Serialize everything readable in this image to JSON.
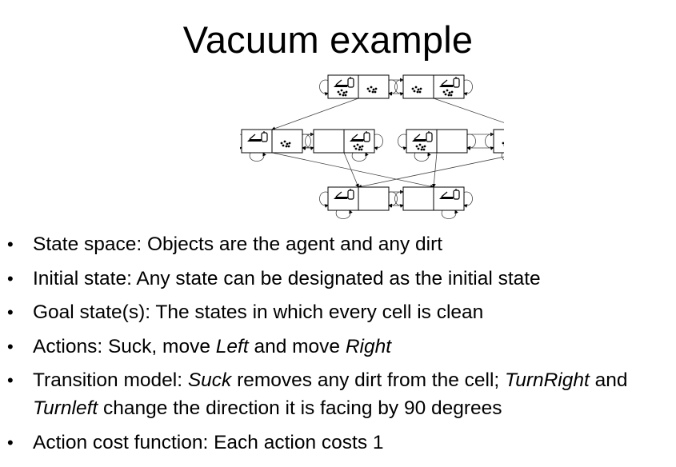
{
  "slide": {
    "title": "Vacuum example",
    "bullet_glyph": "•",
    "bullets": [
      {
        "parts": [
          "State space: Objects are the agent and any dirt"
        ]
      },
      {
        "parts": [
          "Initial state: Any state can be designated as the initial state"
        ]
      },
      {
        "parts": [
          "Goal state(s): The states in which every cell is clean"
        ]
      },
      {
        "parts": [
          "Actions: Suck, move ",
          "Left",
          " and move ",
          "Right"
        ]
      },
      {
        "parts": [
          "Transition model: ",
          "Suck",
          " removes any dirt from the cell; ",
          "TurnRight",
          " and ",
          "Turnleft",
          " change the direction it is facing by 90 degrees"
        ]
      },
      {
        "parts": [
          "Action cost function: Each action costs 1"
        ]
      }
    ]
  },
  "diagram": {
    "icons": {
      "agent": "vacuum-robot-icon",
      "dirt": "dirt-icon"
    },
    "states": [
      {
        "id": 1,
        "left": [
          "agent",
          "dirt"
        ],
        "right": [
          "dirt"
        ]
      },
      {
        "id": 2,
        "left": [
          "dirt"
        ],
        "right": [
          "agent",
          "dirt"
        ]
      },
      {
        "id": 3,
        "left": [
          "agent"
        ],
        "right": [
          "dirt"
        ]
      },
      {
        "id": 4,
        "left": [],
        "right": [
          "agent",
          "dirt"
        ]
      },
      {
        "id": 5,
        "left": [
          "agent",
          "dirt"
        ],
        "right": []
      },
      {
        "id": 6,
        "left": [
          "dirt"
        ],
        "right": [
          "agent"
        ]
      },
      {
        "id": 7,
        "left": [
          "agent"
        ],
        "right": []
      },
      {
        "id": 8,
        "left": [],
        "right": [
          "agent"
        ]
      }
    ]
  }
}
